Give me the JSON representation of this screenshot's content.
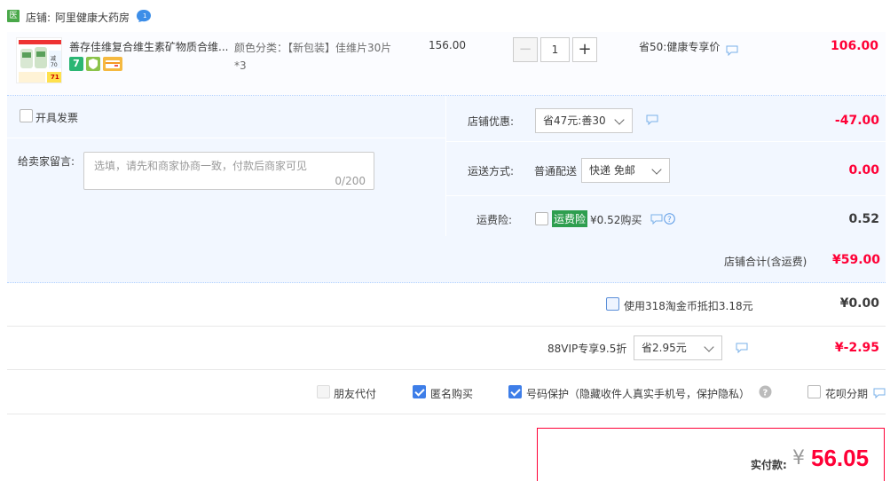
{
  "shop": {
    "icon_label": "医",
    "label": "店铺:",
    "name": "阿里健康大药房"
  },
  "item": {
    "title": "善存佳维复合维生素矿物质合维...",
    "sku_label": "颜色分类：【新包装】佳维片30片*3",
    "unit_price": "156.00",
    "quantity": "1",
    "promo": "省50:健康专享价",
    "total": "106.00",
    "thumb_texts": [
      "减70",
      "71"
    ]
  },
  "invoice": {
    "label": "开具发票"
  },
  "message": {
    "label": "给卖家留言:",
    "placeholder": "选填，请先和商家协商一致，付款后商家可见",
    "counter": "0/200"
  },
  "discount": {
    "label": "店铺优惠:",
    "selected": "省47元:善30",
    "amount": "-47.00"
  },
  "shipping": {
    "label": "运送方式:",
    "method": "普通配送",
    "selected": "快递 免邮",
    "amount": "0.00"
  },
  "insurance": {
    "label": "运费险:",
    "tag": "运费险",
    "price_text": "¥0.52购买",
    "amount": "0.52"
  },
  "shop_total": {
    "label": "店铺合计(含运费)",
    "amount": "¥59.00"
  },
  "coin": {
    "label": "使用318淘金币抵扣3.18元",
    "amount": "¥0.00"
  },
  "vip": {
    "label": "88VIP专享9.5折",
    "selected": "省2.95元",
    "amount": "¥-2.95"
  },
  "options": {
    "friend_pay": "朋友代付",
    "anonymous": "匿名购买",
    "number_protect": "号码保护（隐藏收件人真实手机号，保护隐私）",
    "huabei": "花呗分期"
  },
  "payment": {
    "label": "实付款:",
    "currency": "¥",
    "amount": "56.05"
  },
  "colors": {
    "accent_red": "#ff0036",
    "panel_blue": "#f2f7ff",
    "check_blue": "#3e7ee8"
  }
}
